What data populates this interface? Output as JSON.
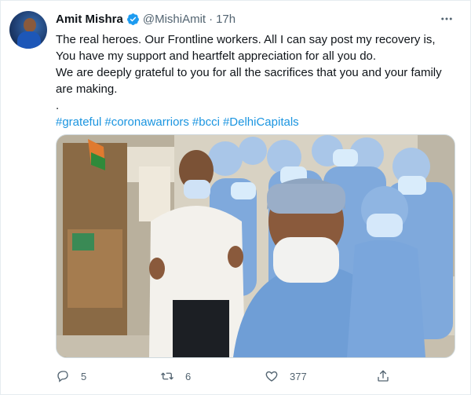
{
  "tweet": {
    "author_name": "Amit Mishra",
    "handle": "@MishiAmit",
    "separator": "·",
    "time": "17h",
    "verified_icon": "verified-badge-icon",
    "text_lines": [
      "The real heroes. Our Frontline workers. All I can say post my recovery is, You have my support and heartfelt appreciation for all you do.",
      "We are deeply grateful to you for all the sacrifices that you and your family are making.",
      "."
    ],
    "hashtags": [
      "#grateful",
      "#coronawarriors",
      "#bcci",
      "#DelhiCapitals"
    ],
    "link_color": "#1b95e0"
  },
  "actions": {
    "reply_count": "5",
    "retweet_count": "6",
    "like_count": "377"
  },
  "icons": {
    "reply": "reply-icon",
    "retweet": "retweet-icon",
    "like": "heart-icon",
    "share": "share-icon",
    "more": "more-icon"
  }
}
